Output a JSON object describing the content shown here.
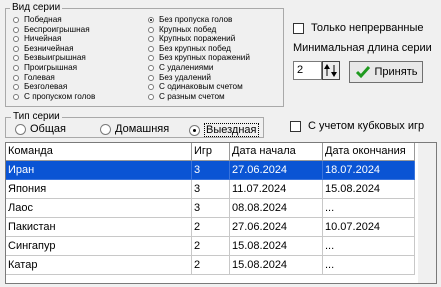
{
  "series_type_group": {
    "title": "Вид серии",
    "left_options": [
      {
        "label": "Победная",
        "checked": false
      },
      {
        "label": "Беспроигрышная",
        "checked": false
      },
      {
        "label": "Ничейная",
        "checked": false
      },
      {
        "label": "Безничейная",
        "checked": false
      },
      {
        "label": "Безвыигрышная",
        "checked": false
      },
      {
        "label": "Проигрышная",
        "checked": false
      },
      {
        "label": "Голевая",
        "checked": false
      },
      {
        "label": "Безголевая",
        "checked": false
      },
      {
        "label": "С пропуском голов",
        "checked": false
      }
    ],
    "right_options": [
      {
        "label": "Без пропуска голов",
        "checked": true
      },
      {
        "label": "Крупных побед",
        "checked": false
      },
      {
        "label": "Крупных поражений",
        "checked": false
      },
      {
        "label": "Без крупных побед",
        "checked": false
      },
      {
        "label": "Без крупных поражений",
        "checked": false
      },
      {
        "label": "С удалениями",
        "checked": false
      },
      {
        "label": "Без удалений",
        "checked": false
      },
      {
        "label": "С одинаковым счетом",
        "checked": false
      },
      {
        "label": "С разным счетом",
        "checked": false
      }
    ]
  },
  "only_continuous": {
    "label": "Только непрерванные",
    "checked": false
  },
  "min_length": {
    "label": "Минимальная длина серии",
    "value": "2"
  },
  "accept_button": {
    "label": "Принять"
  },
  "series_kind_group": {
    "title": "Тип серии",
    "options": [
      {
        "label": "Общая",
        "checked": false
      },
      {
        "label": "Домашняя",
        "checked": false
      },
      {
        "label": "Выездная",
        "checked": true
      }
    ]
  },
  "cup_games": {
    "label": "С учетом кубковых игр",
    "checked": false
  },
  "table": {
    "columns": [
      "Команда",
      "Игр",
      "Дата начала",
      "Дата окончания"
    ],
    "rows": [
      [
        "Иран",
        "3",
        "27.06.2024",
        "18.07.2024"
      ],
      [
        "Япония",
        "3",
        "11.07.2024",
        "15.08.2024"
      ],
      [
        "Лаос",
        "3",
        "08.08.2024",
        "..."
      ],
      [
        "Пакистан",
        "2",
        "27.06.2024",
        "10.07.2024"
      ],
      [
        "Сингапур",
        "2",
        "15.08.2024",
        "..."
      ],
      [
        "Катар",
        "2",
        "15.08.2024",
        "..."
      ]
    ],
    "selected_row": 0
  },
  "colors": {
    "selection": "#0a54d4",
    "accept_check": "#1f9a1f"
  }
}
